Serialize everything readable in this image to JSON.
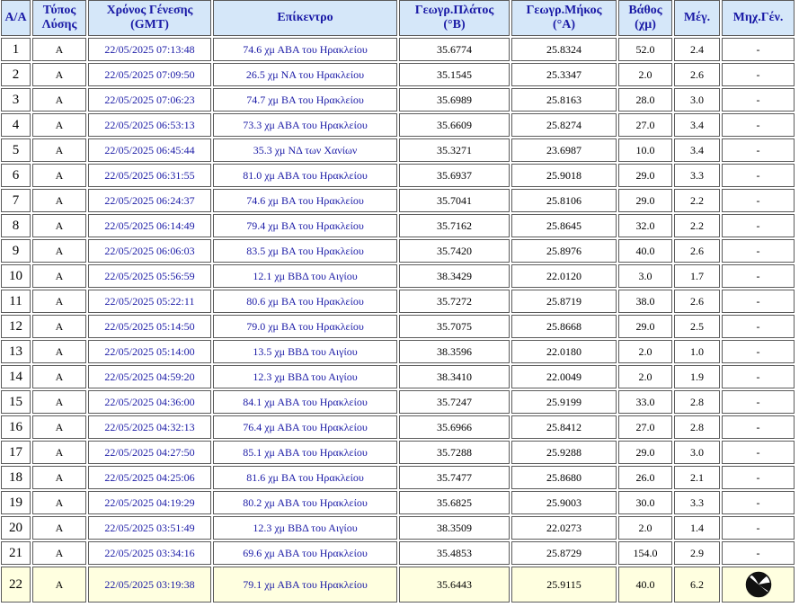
{
  "headers": {
    "aa": "Α/Α",
    "type": "Τύπος\nΛύσης",
    "time": "Χρόνος Γένεσης\n(GMT)",
    "epicenter": "Επίκεντρο",
    "lat": "Γεωγρ.Πλάτος\n(°B)",
    "lon": "Γεωγρ.Μήκος\n(°Α)",
    "depth": "Βάθος\n(χμ)",
    "mag": "Μέγ.",
    "mech": "Μηχ.Γέν."
  },
  "rows": [
    {
      "aa": "1",
      "type": "A",
      "time": "22/05/2025 07:13:48",
      "epicenter": "74.6 χμ ΑΒΑ του Ηρακλείου",
      "lat": "35.6774",
      "lon": "25.8324",
      "depth": "52.0",
      "mag": "2.4",
      "mech": "-"
    },
    {
      "aa": "2",
      "type": "A",
      "time": "22/05/2025 07:09:50",
      "epicenter": "26.5 χμ ΝΑ του Ηρακλείου",
      "lat": "35.1545",
      "lon": "25.3347",
      "depth": "2.0",
      "mag": "2.6",
      "mech": "-"
    },
    {
      "aa": "3",
      "type": "A",
      "time": "22/05/2025 07:06:23",
      "epicenter": "74.7 χμ ΒΑ του Ηρακλείου",
      "lat": "35.6989",
      "lon": "25.8163",
      "depth": "28.0",
      "mag": "3.0",
      "mech": "-"
    },
    {
      "aa": "4",
      "type": "A",
      "time": "22/05/2025 06:53:13",
      "epicenter": "73.3 χμ ΑΒΑ του Ηρακλείου",
      "lat": "35.6609",
      "lon": "25.8274",
      "depth": "27.0",
      "mag": "3.4",
      "mech": "-"
    },
    {
      "aa": "5",
      "type": "A",
      "time": "22/05/2025 06:45:44",
      "epicenter": "35.3 χμ ΝΔ των Χανίων",
      "lat": "35.3271",
      "lon": "23.6987",
      "depth": "10.0",
      "mag": "3.4",
      "mech": "-"
    },
    {
      "aa": "6",
      "type": "A",
      "time": "22/05/2025 06:31:55",
      "epicenter": "81.0 χμ ΑΒΑ του Ηρακλείου",
      "lat": "35.6937",
      "lon": "25.9018",
      "depth": "29.0",
      "mag": "3.3",
      "mech": "-"
    },
    {
      "aa": "7",
      "type": "A",
      "time": "22/05/2025 06:24:37",
      "epicenter": "74.6 χμ ΒΑ του Ηρακλείου",
      "lat": "35.7041",
      "lon": "25.8106",
      "depth": "29.0",
      "mag": "2.2",
      "mech": "-"
    },
    {
      "aa": "8",
      "type": "A",
      "time": "22/05/2025 06:14:49",
      "epicenter": "79.4 χμ ΒΑ του Ηρακλείου",
      "lat": "35.7162",
      "lon": "25.8645",
      "depth": "32.0",
      "mag": "2.2",
      "mech": "-"
    },
    {
      "aa": "9",
      "type": "A",
      "time": "22/05/2025 06:06:03",
      "epicenter": "83.5 χμ ΒΑ του Ηρακλείου",
      "lat": "35.7420",
      "lon": "25.8976",
      "depth": "40.0",
      "mag": "2.6",
      "mech": "-"
    },
    {
      "aa": "10",
      "type": "A",
      "time": "22/05/2025 05:56:59",
      "epicenter": "12.1 χμ ΒΒΔ του Αιγίου",
      "lat": "38.3429",
      "lon": "22.0120",
      "depth": "3.0",
      "mag": "1.7",
      "mech": "-"
    },
    {
      "aa": "11",
      "type": "A",
      "time": "22/05/2025 05:22:11",
      "epicenter": "80.6 χμ ΒΑ του Ηρακλείου",
      "lat": "35.7272",
      "lon": "25.8719",
      "depth": "38.0",
      "mag": "2.6",
      "mech": "-"
    },
    {
      "aa": "12",
      "type": "A",
      "time": "22/05/2025 05:14:50",
      "epicenter": "79.0 χμ ΒΑ του Ηρακλείου",
      "lat": "35.7075",
      "lon": "25.8668",
      "depth": "29.0",
      "mag": "2.5",
      "mech": "-"
    },
    {
      "aa": "13",
      "type": "A",
      "time": "22/05/2025 05:14:00",
      "epicenter": "13.5 χμ ΒΒΔ του Αιγίου",
      "lat": "38.3596",
      "lon": "22.0180",
      "depth": "2.0",
      "mag": "1.0",
      "mech": "-"
    },
    {
      "aa": "14",
      "type": "A",
      "time": "22/05/2025 04:59:20",
      "epicenter": "12.3 χμ ΒΒΔ του Αιγίου",
      "lat": "38.3410",
      "lon": "22.0049",
      "depth": "2.0",
      "mag": "1.9",
      "mech": "-"
    },
    {
      "aa": "15",
      "type": "A",
      "time": "22/05/2025 04:36:00",
      "epicenter": "84.1 χμ ΑΒΑ του Ηρακλείου",
      "lat": "35.7247",
      "lon": "25.9199",
      "depth": "33.0",
      "mag": "2.8",
      "mech": "-"
    },
    {
      "aa": "16",
      "type": "A",
      "time": "22/05/2025 04:32:13",
      "epicenter": "76.4 χμ ΑΒΑ του Ηρακλείου",
      "lat": "35.6966",
      "lon": "25.8412",
      "depth": "27.0",
      "mag": "2.8",
      "mech": "-"
    },
    {
      "aa": "17",
      "type": "A",
      "time": "22/05/2025 04:27:50",
      "epicenter": "85.1 χμ ΑΒΑ του Ηρακλείου",
      "lat": "35.7288",
      "lon": "25.9288",
      "depth": "29.0",
      "mag": "3.0",
      "mech": "-"
    },
    {
      "aa": "18",
      "type": "A",
      "time": "22/05/2025 04:25:06",
      "epicenter": "81.6 χμ ΒΑ του Ηρακλείου",
      "lat": "35.7477",
      "lon": "25.8680",
      "depth": "26.0",
      "mag": "2.1",
      "mech": "-"
    },
    {
      "aa": "19",
      "type": "A",
      "time": "22/05/2025 04:19:29",
      "epicenter": "80.2 χμ ΑΒΑ του Ηρακλείου",
      "lat": "35.6825",
      "lon": "25.9003",
      "depth": "30.0",
      "mag": "3.3",
      "mech": "-"
    },
    {
      "aa": "20",
      "type": "A",
      "time": "22/05/2025 03:51:49",
      "epicenter": "12.3 χμ ΒΒΔ του Αιγίου",
      "lat": "38.3509",
      "lon": "22.0273",
      "depth": "2.0",
      "mag": "1.4",
      "mech": "-"
    },
    {
      "aa": "21",
      "type": "A",
      "time": "22/05/2025 03:34:16",
      "epicenter": "69.6 χμ ΑΒΑ του Ηρακλείου",
      "lat": "35.4853",
      "lon": "25.8729",
      "depth": "154.0",
      "mag": "2.9",
      "mech": "-"
    },
    {
      "aa": "22",
      "type": "A",
      "time": "22/05/2025 03:19:38",
      "epicenter": "79.1 χμ ΑΒΑ του Ηρακλείου",
      "lat": "35.6443",
      "lon": "25.9115",
      "depth": "40.0",
      "mag": "6.2",
      "mech": "",
      "mech_icon": "focal-mechanism-beachball-icon",
      "highlight": true
    }
  ],
  "colors": {
    "header_bg": "#d5e7f9",
    "header_text": "#1a1aa6",
    "link_text": "#1a1aa6",
    "highlight_row_bg": "#ffffe0"
  }
}
